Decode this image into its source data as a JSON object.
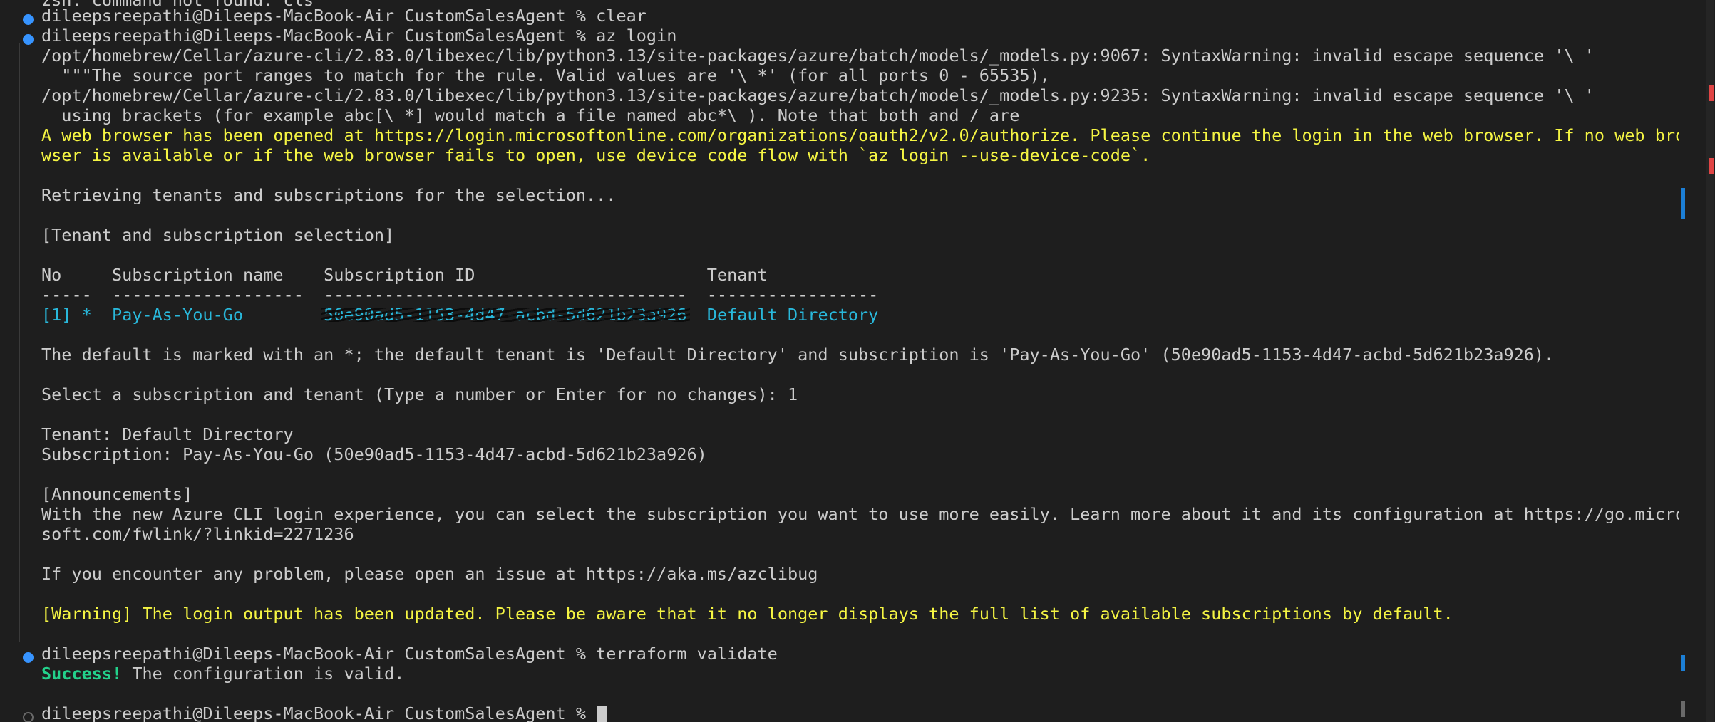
{
  "terminal": {
    "lines": [
      {
        "text": "zsh: command not found: cls",
        "color": "default"
      },
      {
        "text": "dileepsreepathi@Dileeps-MacBook-Air CustomSalesAgent % clear",
        "color": "default"
      },
      {
        "text": "dileepsreepathi@Dileeps-MacBook-Air CustomSalesAgent % az login",
        "color": "default"
      },
      {
        "text": "/opt/homebrew/Cellar/azure-cli/2.83.0/libexec/lib/python3.13/site-packages/azure/batch/models/_models.py:9067: SyntaxWarning: invalid escape sequence '\\ '",
        "color": "default"
      },
      {
        "text": "  \"\"\"The source port ranges to match for the rule. Valid values are '\\ *' (for all ports 0 - 65535),",
        "color": "default"
      },
      {
        "text": "/opt/homebrew/Cellar/azure-cli/2.83.0/libexec/lib/python3.13/site-packages/azure/batch/models/_models.py:9235: SyntaxWarning: invalid escape sequence '\\ '",
        "color": "default"
      },
      {
        "text": "  using brackets (for example abc[\\ *] would match a file named abc*\\ ). Note that both and / are",
        "color": "default"
      },
      {
        "text": "A web browser has been opened at https://login.microsoftonline.com/organizations/oauth2/v2.0/authorize. Please continue the login in the web browser. If no web bro",
        "color": "yellow"
      },
      {
        "text": "wser is available or if the web browser fails to open, use device code flow with `az login --use-device-code`.",
        "color": "yellow"
      },
      {
        "text": "Retrieving tenants and subscriptions for the selection...",
        "color": "default"
      },
      {
        "text": "[Tenant and subscription selection]",
        "color": "default"
      },
      {
        "text": "No     Subscription name    Subscription ID                       Tenant",
        "color": "default"
      },
      {
        "text": "-----  -------------------  ------------------------------------  -----------------",
        "color": "default"
      },
      {
        "text": "The default is marked with an *; the default tenant is 'Default Directory' and subscription is 'Pay-As-You-Go' (50e90ad5-1153-4d47-acbd-5d621b23a926).",
        "color": "default"
      },
      {
        "text": "Select a subscription and tenant (Type a number or Enter for no changes): 1",
        "color": "default"
      },
      {
        "text": "Tenant: Default Directory",
        "color": "default"
      },
      {
        "text": "Subscription: Pay-As-You-Go (50e90ad5-1153-4d47-acbd-5d621b23a926)",
        "color": "default"
      },
      {
        "text": "[Announcements]",
        "color": "default"
      },
      {
        "text": "With the new Azure CLI login experience, you can select the subscription you want to use more easily. Learn more about it and its configuration at https://go.micro",
        "color": "default"
      },
      {
        "text": "soft.com/fwlink/?linkid=2271236",
        "color": "default"
      },
      {
        "text": "If you encounter any problem, please open an issue at https://aka.ms/azclibug",
        "color": "default"
      },
      {
        "text": "[Warning] The login output has been updated. Please be aware that it no longer displays the full list of available subscriptions by default.",
        "color": "yellow"
      },
      {
        "text": "dileepsreepathi@Dileeps-MacBook-Air CustomSalesAgent % terraform validate",
        "color": "default"
      },
      {
        "text": " The configuration is valid.",
        "color": "default"
      },
      {
        "text": "dileepsreepathi@Dileeps-MacBook-Air CustomSalesAgent % ",
        "color": "default"
      }
    ],
    "table_row": {
      "no": "[1] *",
      "name": "Pay-As-You-Go",
      "sub_id": "50e90ad5-1153-4d47-acbd-5d621b23a926",
      "tenant": "Default Directory"
    },
    "success_label": "Success!"
  },
  "colors": {
    "background": "#1e1e1e",
    "text": "#cccccc",
    "yellow": "#f5f543",
    "cyan": "#29b8db",
    "green": "#23d18b",
    "prompt_dot": "#3794ff",
    "scroll_mark_red": "#e04545",
    "scroll_mark_blue": "#1c7fd6"
  },
  "icons": {
    "prompt_marker": "filled-circle",
    "idle_marker": "hollow-circle"
  }
}
